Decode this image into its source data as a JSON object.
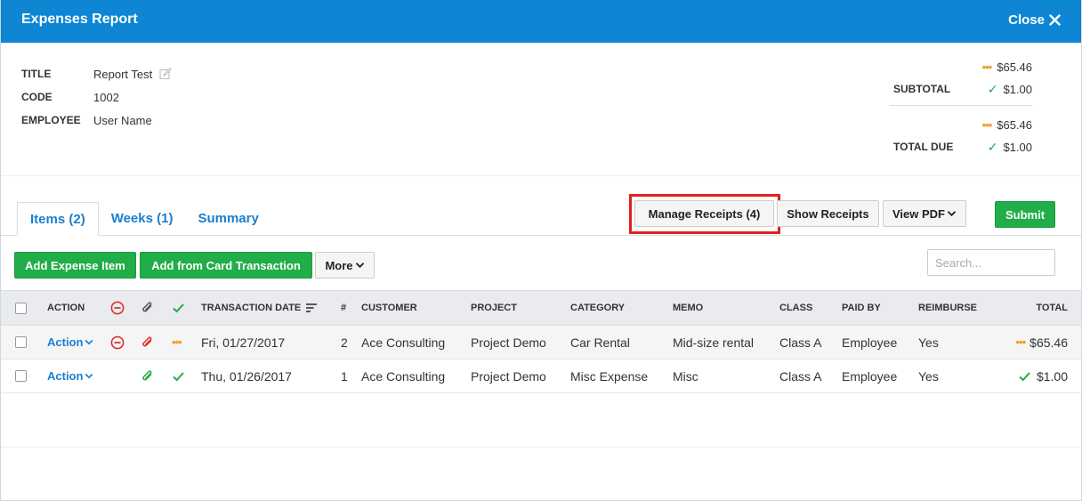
{
  "header": {
    "title": "Expenses Report",
    "close_label": "Close"
  },
  "info": {
    "title_label": "TITLE",
    "title_value": "Report Test",
    "code_label": "CODE",
    "code_value": "1002",
    "employee_label": "EMPLOYEE",
    "employee_value": "User Name"
  },
  "totals": {
    "subtotal_label": "SUBTOTAL",
    "subtotal_pending": "$65.46",
    "subtotal_approved": "$1.00",
    "total_label": "TOTAL DUE",
    "total_pending": "$65.46",
    "total_approved": "$1.00"
  },
  "tabs": [
    {
      "label": "Items (2)",
      "active": true
    },
    {
      "label": "Weeks (1)",
      "active": false
    },
    {
      "label": "Summary",
      "active": false
    }
  ],
  "toolbar": {
    "manage_receipts": "Manage Receipts (4)",
    "show_receipts": "Show Receipts",
    "view_pdf": "View PDF",
    "submit": "Submit",
    "add_expense": "Add Expense Item",
    "add_card": "Add from Card Transaction",
    "more": "More",
    "search_placeholder": "Search..."
  },
  "columns": {
    "action": "ACTION",
    "date": "TRANSACTION DATE",
    "num": "#",
    "customer": "CUSTOMER",
    "project": "PROJECT",
    "category": "CATEGORY",
    "memo": "MEMO",
    "class": "CLASS",
    "paid_by": "PAID BY",
    "reimburse": "REIMBURSE",
    "total": "TOTAL"
  },
  "rows": [
    {
      "action": "Action",
      "date": "Fri, 01/27/2017",
      "num": "2",
      "customer": "Ace Consulting",
      "project": "Project Demo",
      "category": "Car Rental",
      "memo": "Mid-size rental",
      "class": "Class A",
      "paid_by": "Employee",
      "reimburse": "Yes",
      "total": "$65.46",
      "status": "pending"
    },
    {
      "action": "Action",
      "date": "Thu, 01/26/2017",
      "num": "1",
      "customer": "Ace Consulting",
      "project": "Project Demo",
      "category": "Misc Expense",
      "memo": "Misc",
      "class": "Class A",
      "paid_by": "Employee",
      "reimburse": "Yes",
      "total": "$1.00",
      "status": "approved"
    }
  ],
  "colors": {
    "header": "#0e86d4",
    "link": "#1a7fd0",
    "green": "#21ad48",
    "pending": "#f0a030",
    "highlight": "#e02020"
  }
}
